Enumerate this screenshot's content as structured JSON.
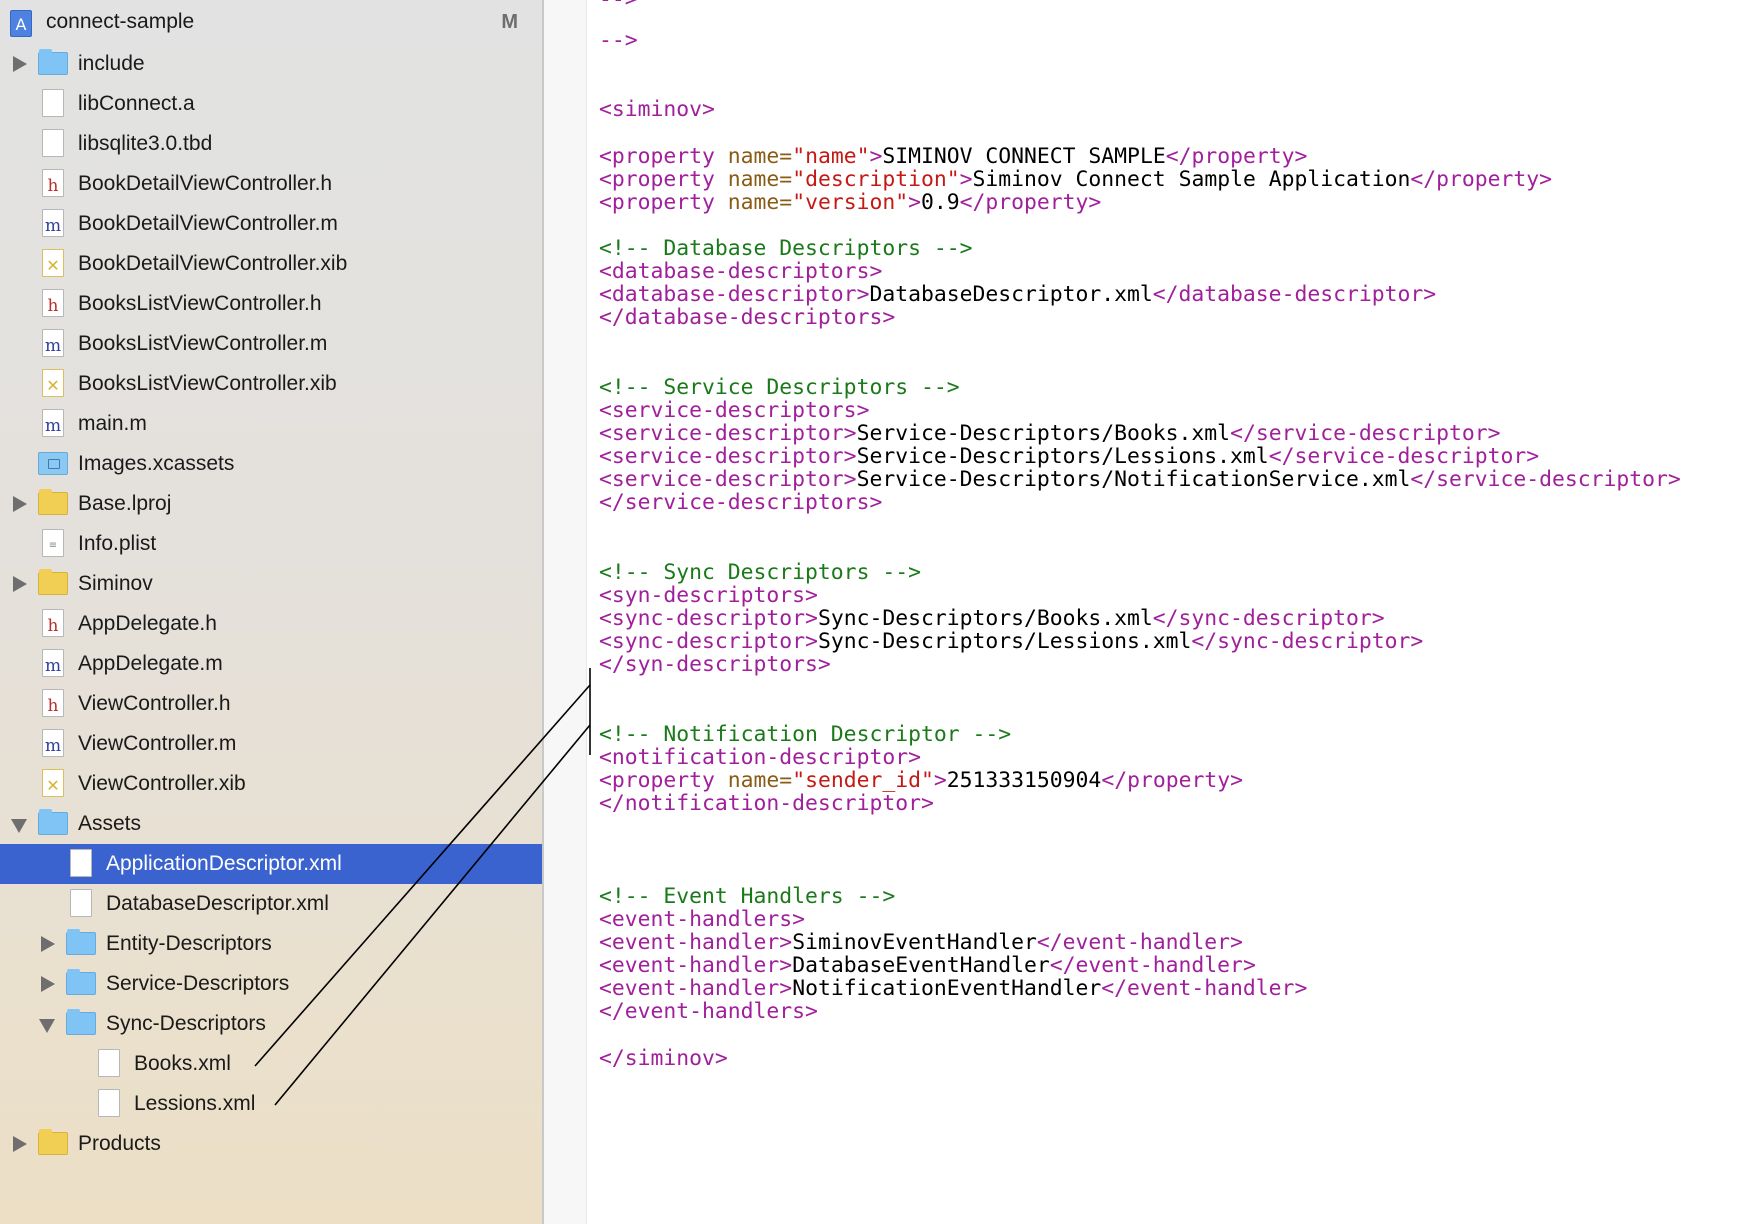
{
  "navigator": {
    "project": {
      "name": "connect-sample",
      "badge": "M"
    },
    "items": [
      {
        "label": "include",
        "icon": "folder-blue",
        "disclosure": "closed"
      },
      {
        "label": "libConnect.a",
        "icon": "file-generic"
      },
      {
        "label": "libsqlite3.0.tbd",
        "icon": "file-generic"
      },
      {
        "label": "BookDetailViewController.h",
        "icon": "file-h"
      },
      {
        "label": "BookDetailViewController.m",
        "icon": "file-m"
      },
      {
        "label": "BookDetailViewController.xib",
        "icon": "file-xib"
      },
      {
        "label": "BooksListViewController.h",
        "icon": "file-h"
      },
      {
        "label": "BooksListViewController.m",
        "icon": "file-m"
      },
      {
        "label": "BooksListViewController.xib",
        "icon": "file-xib"
      },
      {
        "label": "main.m",
        "icon": "file-m"
      },
      {
        "label": "Images.xcassets",
        "icon": "asset-catalog"
      },
      {
        "label": "Base.lproj",
        "icon": "folder-yellow",
        "disclosure": "closed"
      },
      {
        "label": "Info.plist",
        "icon": "file-plist"
      },
      {
        "label": "Siminov",
        "icon": "folder-yellow",
        "disclosure": "closed"
      },
      {
        "label": "AppDelegate.h",
        "icon": "file-h"
      },
      {
        "label": "AppDelegate.m",
        "icon": "file-m"
      },
      {
        "label": "ViewController.h",
        "icon": "file-h"
      },
      {
        "label": "ViewController.m",
        "icon": "file-m"
      },
      {
        "label": "ViewController.xib",
        "icon": "file-xib"
      },
      {
        "label": "Assets",
        "icon": "folder-blue",
        "disclosure": "open"
      },
      {
        "label": "ApplicationDescriptor.xml",
        "icon": "file-generic",
        "selected": true
      },
      {
        "label": "DatabaseDescriptor.xml",
        "icon": "file-generic"
      },
      {
        "label": "Entity-Descriptors",
        "icon": "folder-blue",
        "disclosure": "closed"
      },
      {
        "label": "Service-Descriptors",
        "icon": "folder-blue",
        "disclosure": "closed"
      },
      {
        "label": "Sync-Descriptors",
        "icon": "folder-blue",
        "disclosure": "open"
      },
      {
        "label": "Books.xml",
        "icon": "file-generic"
      },
      {
        "label": "Lessions.xml",
        "icon": "file-generic"
      },
      {
        "label": "Products",
        "icon": "folder-yellow",
        "disclosure": "closed"
      }
    ]
  },
  "editor": {
    "lines": {
      "l01": "-->",
      "l02": "<siminov>",
      "l03a": "<property",
      "l03b": "name=",
      "l03c": "\"name\"",
      "l03d": ">",
      "l03e": "SIMINOV CONNECT SAMPLE",
      "l03f": "</property>",
      "l04a": "<property",
      "l04b": "name=",
      "l04c": "\"description\"",
      "l04d": ">",
      "l04e": "Siminov Connect Sample Application",
      "l04f": "</property>",
      "l05a": "<property",
      "l05b": "name=",
      "l05c": "\"version\"",
      "l05d": ">",
      "l05e": "0.9",
      "l05f": "</property>",
      "l06": "<!-- Database Descriptors -->",
      "l07": "<database-descriptors>",
      "l08a": "<database-descriptor>",
      "l08b": "DatabaseDescriptor.xml",
      "l08c": "</database-descriptor>",
      "l09": "</database-descriptors>",
      "l10": "<!-- Service Descriptors -->",
      "l11": "<service-descriptors>",
      "l12a": "<service-descriptor>",
      "l12b": "Service-Descriptors/Books.xml",
      "l12c": "</service-descriptor>",
      "l13a": "<service-descriptor>",
      "l13b": "Service-Descriptors/Lessions.xml",
      "l13c": "</service-descriptor>",
      "l14a": "<service-descriptor>",
      "l14b": "Service-Descriptors/NotificationService.xml",
      "l14c": "</service-descriptor>",
      "l15": "</service-descriptors>",
      "l16": "<!-- Sync Descriptors -->",
      "l17": "<syn-descriptors>",
      "l18a": "<sync-descriptor>",
      "l18b": "Sync-Descriptors/Books.xml",
      "l18c": "</sync-descriptor>",
      "l19a": "<sync-descriptor>",
      "l19b": "Sync-Descriptors/Lessions.xml",
      "l19c": "</sync-descriptor>",
      "l20": "</syn-descriptors>",
      "l21": "<!-- Notification Descriptor -->",
      "l22": "<notification-descriptor>",
      "l23a": "<property",
      "l23b": "name=",
      "l23c": "\"sender_id\"",
      "l23d": ">",
      "l23e": "251333150904",
      "l23f": "</property>",
      "l24": "</notification-descriptor>",
      "l25": "<!-- Event Handlers -->",
      "l26": "<event-handlers>",
      "l27a": "<event-handler>",
      "l27b": "SiminovEventHandler",
      "l27c": "</event-handler>",
      "l28a": "<event-handler>",
      "l28b": "DatabaseEventHandler",
      "l28c": "</event-handler>",
      "l29a": "<event-handler>",
      "l29b": "NotificationEventHandler",
      "l29c": "</event-handler>",
      "l30": "</event-handlers>",
      "l31": "</siminov>"
    }
  },
  "colors": {
    "selection": "#3a63d0",
    "xml_tag": "#a0209c",
    "xml_attribute": "#8a5b15",
    "xml_string": "#c41a16",
    "xml_comment": "#1a7a1a"
  }
}
